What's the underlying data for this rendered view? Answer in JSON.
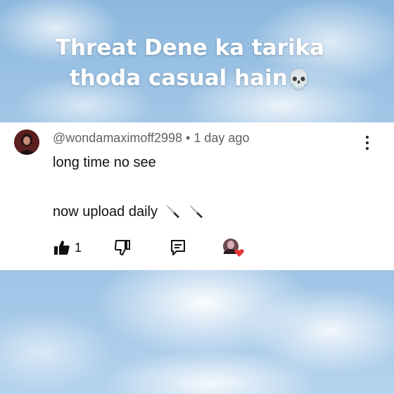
{
  "caption": {
    "line1": "Threat Dene ka tarika",
    "line2": "thoda casual hain",
    "emoji": "💀"
  },
  "comment": {
    "handle": "@wondamaximoff2998",
    "separator": "•",
    "time": "1 day ago",
    "line1": "long time no see",
    "line2": "now upload daily",
    "line2_emoji_icons": [
      "knife-icon",
      "knife-icon"
    ],
    "likes": "1",
    "actions": [
      "thumbs-up-icon",
      "thumbs-down-icon",
      "reply-icon",
      "creator-heart-icon"
    ]
  },
  "colors": {
    "sky": "#a8cbe9",
    "card": "#ffffff",
    "meta_text": "#606060",
    "body_text": "#111111",
    "heart": "#e53935"
  }
}
